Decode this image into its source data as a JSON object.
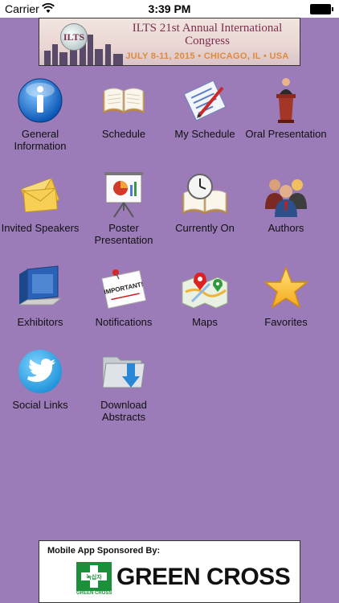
{
  "status_bar": {
    "carrier": "Carrier",
    "time": "3:39 PM"
  },
  "banner": {
    "logo_text": "ILTS",
    "title": "ILTS 21st Annual International Congress",
    "subtitle": "JULY 8-11, 2015 • CHICAGO, IL • USA"
  },
  "menu": {
    "general_information": "General Information",
    "schedule": "Schedule",
    "my_schedule": "My Schedule",
    "oral_presentation": "Oral Presentation",
    "invited_speakers": "Invited Speakers",
    "poster_presentation": "Poster Presentation",
    "currently_on": "Currently On",
    "authors": "Authors",
    "exhibitors": "Exhibitors",
    "notifications": "Notifications",
    "maps": "Maps",
    "favorites": "Favorites",
    "social_links": "Social Links",
    "download_abstracts": "Download Abstracts"
  },
  "icons": {
    "general_information": "info-icon",
    "schedule": "open-book-icon",
    "my_schedule": "checklist-icon",
    "oral_presentation": "podium-icon",
    "invited_speakers": "envelope-icon",
    "poster_presentation": "easel-chart-icon",
    "currently_on": "clock-book-icon",
    "authors": "people-icon",
    "exhibitors": "booth-icon",
    "notifications": "important-note-icon",
    "maps": "map-icon",
    "favorites": "star-icon",
    "social_links": "twitter-icon",
    "download_abstracts": "download-folder-icon"
  },
  "sponsor": {
    "caption": "Mobile App Sponsored By:",
    "name": "GREEN CROSS",
    "logo_small_text": "GREEN CROSS",
    "logo_korean": "녹십자"
  },
  "colors": {
    "background": "#9b7bb8",
    "accent_green": "#1b8f3a"
  }
}
